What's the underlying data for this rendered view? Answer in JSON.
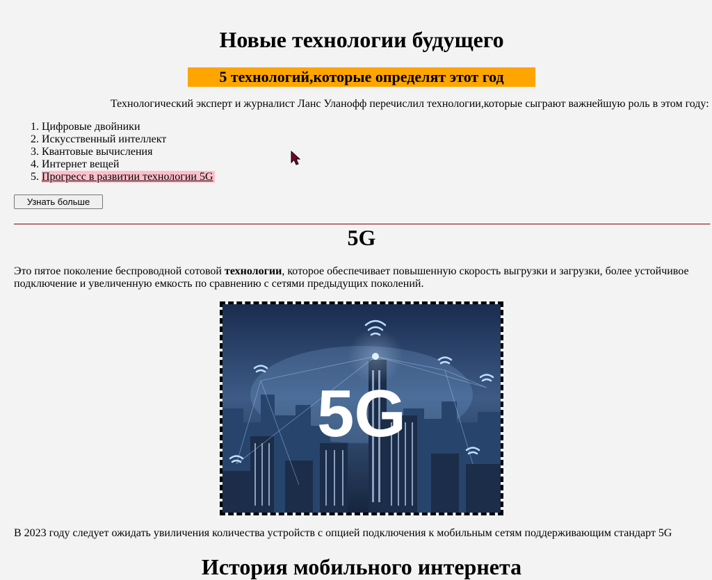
{
  "header": {
    "title": "Новые технологии будущего",
    "subtitle": "5 технологий,которые определят этот год",
    "subtitle_bg": "#ffa500"
  },
  "intro": "Технологический эксперт и журналист Ланс Уланофф перечислил технологии,которые сыграют важнейшую роль в этом году:",
  "tech_list": [
    "Цифровые двойники",
    "Искусственный интеллект",
    "Квантовые вычисления",
    "Интернет вещей",
    "Прогресс в развитии технологии 5G"
  ],
  "learn_more_button": "Узнать больше",
  "section_5g": {
    "heading": "5G",
    "text_before_bold": "Это пятое поколение беспроводной сотовой ",
    "text_bold": "технологии",
    "text_after_bold": ", которое обеспечивает повышенную скорость выгрузки и загрузки, более устойчивое подключение и увеличенную емкость по сравнению с сетями предыдущих поколений.",
    "image_label": "5G",
    "after_image": "В 2023 году следует ожидать увиличения количества устройств с опцией подключения к мобильным сетям поддерживающим стандарт 5G"
  },
  "history_heading": "История мобильного интернета",
  "colors": {
    "page_bg": "#f4f3f3",
    "highlight_link_bg": "#ffc0cb",
    "divider": "#8b0000"
  }
}
